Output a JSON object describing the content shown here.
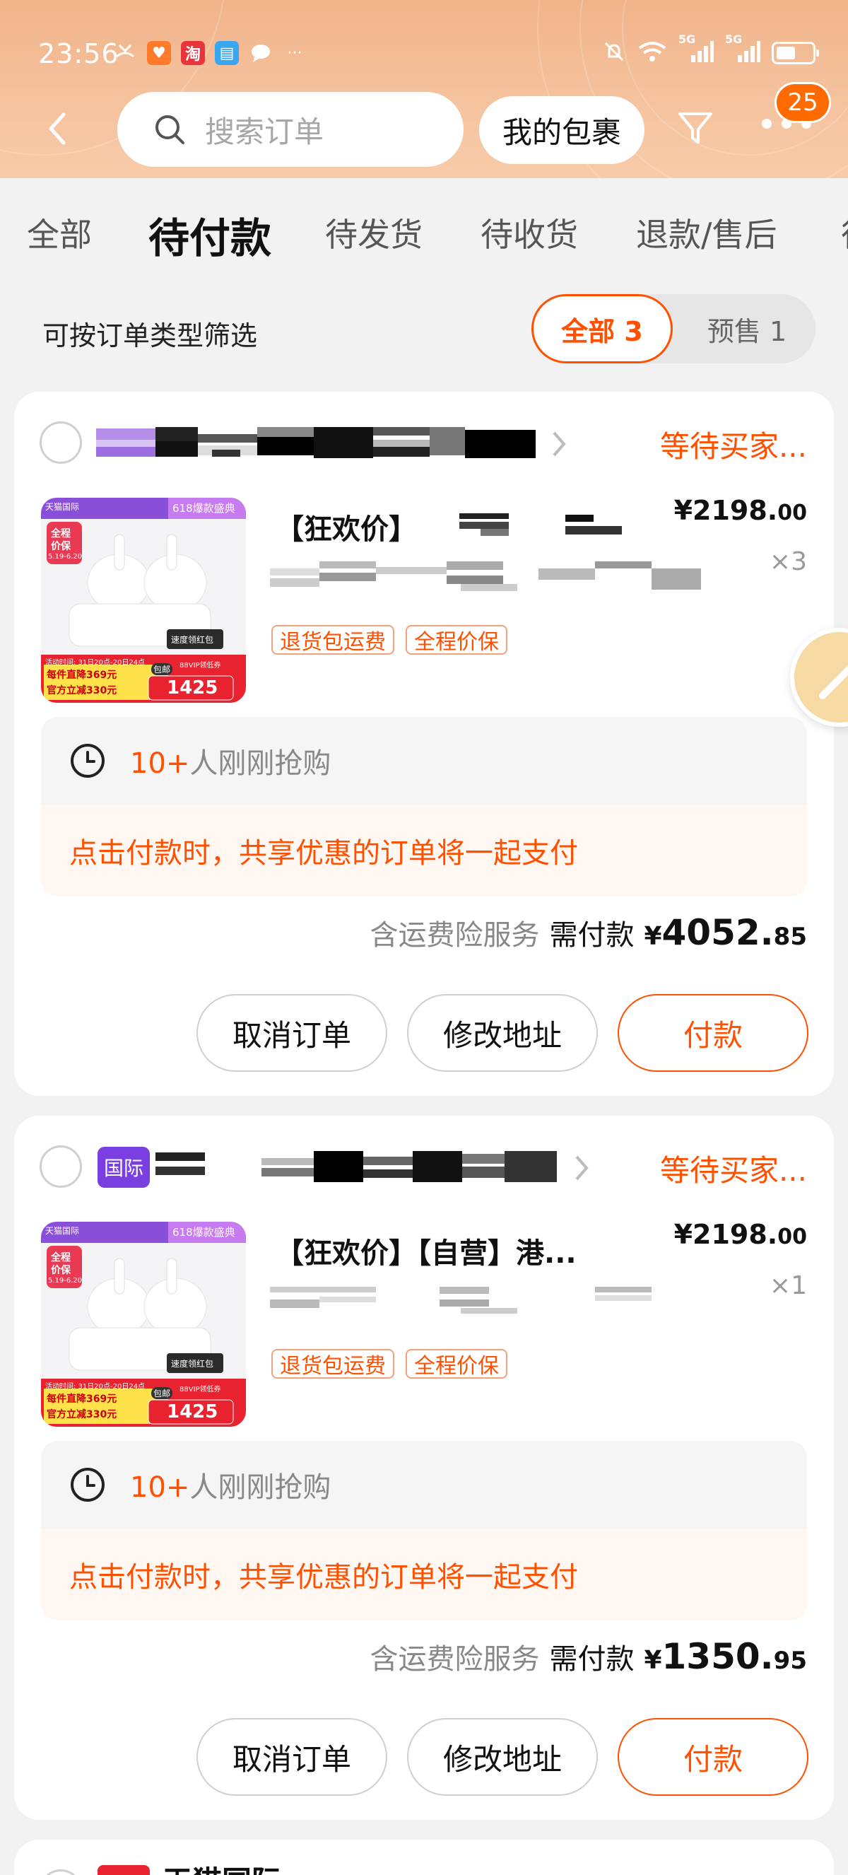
{
  "status_bar": {
    "time": "23:56",
    "icons_left": [
      "missed-call-icon",
      "heart-app-icon",
      "taobao-app-icon",
      "book-app-icon",
      "chat-bubble-icon",
      "more-dots-icon"
    ],
    "icons_right": [
      "mute-icon",
      "wifi-icon",
      "5g-signal-icon",
      "5g-signal-icon",
      "battery-icon"
    ],
    "signal_label_1": "5G",
    "signal_label_2": "5G"
  },
  "header": {
    "search_placeholder": "搜索订单",
    "packages_button": "我的包裹",
    "more_badge": "25",
    "colors": {
      "header_bg": "#f3bd97",
      "accent": "#ff5000"
    }
  },
  "tabs": [
    "全部",
    "待付款",
    "待发货",
    "待收货",
    "退款/售后"
  ],
  "active_tab": "待付款",
  "filter": {
    "label": "可按订单类型筛选",
    "all": "全部 3",
    "presale": "预售 1"
  },
  "orders": [
    {
      "status": "等待买家...",
      "product_title": "【狂欢价】",
      "price_int": "¥2198.",
      "price_dec": "00",
      "qty": "×3",
      "tags": [
        "退货包运费",
        "全程价保"
      ],
      "thumb": {
        "banner": "618爆款盛典",
        "badge_line1": "全程",
        "badge_line2": "价保",
        "badge_date": "5.19-6.20",
        "promo_time": "活动时间: 31日20点-20日24点",
        "promo_line1": "每件直降369元",
        "promo_line2": "官方立减330元",
        "coupon": "88VIP领低券",
        "price": "1425",
        "red_packet": "速度领红包",
        "free_ship": "包邮",
        "brand": "天猫国际"
      },
      "rush_count": "10+",
      "rush_text": "人刚刚抢购",
      "share_notice": "点击付款时，共享优惠的订单将一起支付",
      "insurance": "含运费险服务",
      "need_pay": "需付款",
      "total_yen": "¥",
      "total_int": "4052.",
      "total_dec": "85",
      "buttons": [
        "取消订单",
        "修改地址",
        "付款"
      ]
    },
    {
      "shop_badge": "国际",
      "status": "等待买家...",
      "product_title": "【狂欢价】【自营】港...",
      "price_int": "¥2198.",
      "price_dec": "00",
      "qty": "×1",
      "tags": [
        "退货包运费",
        "全程价保"
      ],
      "thumb": {
        "banner": "618爆款盛典",
        "badge_line1": "全程",
        "badge_line2": "价保",
        "badge_date": "5.19-6.20",
        "promo_time": "活动时间: 31日20点-20日24点",
        "promo_line1": "每件直降369元",
        "promo_line2": "官方立减330元",
        "coupon": "88VIP领低券",
        "price": "1425",
        "red_packet": "速度领红包",
        "free_ship": "包邮",
        "brand": "天猫国际"
      },
      "rush_count": "10+",
      "rush_text": "人刚刚抢购",
      "share_notice": "点击付款时，共享优惠的订单将一起支付",
      "insurance": "含运费险服务",
      "need_pay": "需付款",
      "total_yen": "¥",
      "total_int": "1350.",
      "total_dec": "95",
      "buttons": [
        "取消订单",
        "修改地址",
        "付款"
      ]
    }
  ],
  "third_card_partial_title": "天猫国际"
}
